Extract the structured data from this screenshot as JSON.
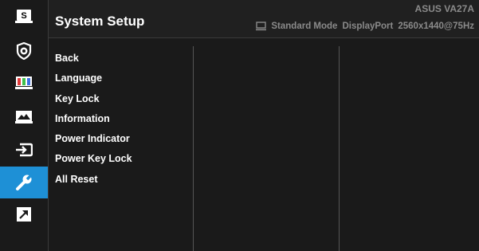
{
  "header": {
    "title": "System Setup",
    "model": "ASUS  VA27A",
    "mode": "Standard Mode",
    "input": "DisplayPort",
    "resolution": "2560x1440@75Hz",
    "status_icon": "monitor-icon"
  },
  "sidebar": {
    "items": [
      {
        "name": "splendid",
        "icon": "s-box-icon",
        "label": "S"
      },
      {
        "name": "eye-care",
        "icon": "eye-shield-icon"
      },
      {
        "name": "color",
        "icon": "color-bars-icon"
      },
      {
        "name": "image",
        "icon": "image-icon"
      },
      {
        "name": "input-select",
        "icon": "input-icon"
      },
      {
        "name": "system-setup",
        "icon": "wrench-icon",
        "active": true
      },
      {
        "name": "shortcut",
        "icon": "shortcut-arrow-icon"
      }
    ]
  },
  "menu": {
    "items": [
      "Back",
      "Language",
      "Key Lock",
      "Information",
      "Power Indicator",
      "Power Key Lock",
      "All Reset"
    ]
  },
  "colors": {
    "accent": "#1e90d6",
    "background": "#1a1a1a",
    "text": "#ffffff",
    "muted": "#8a8a8a"
  }
}
